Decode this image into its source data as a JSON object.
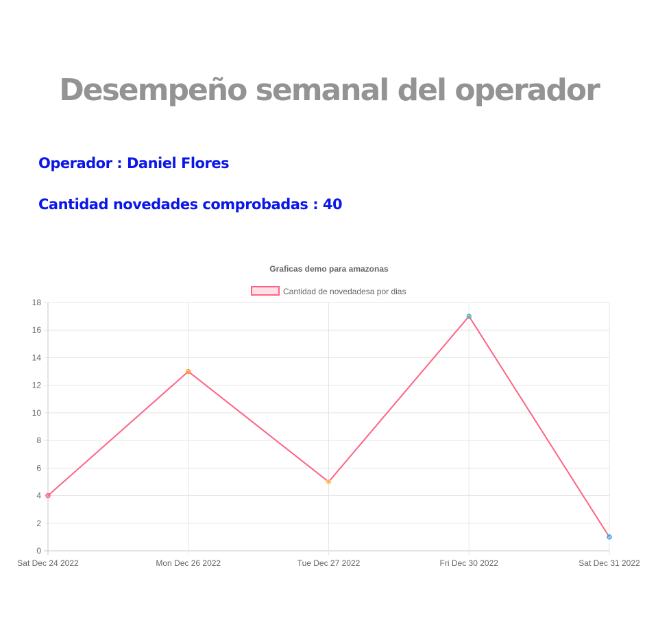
{
  "header": {
    "title": "Desempeño semanal del operador"
  },
  "info": {
    "operator_label": "Operador : Daniel Flores",
    "count_label": "Cantidad novedades comprobadas : 40",
    "text_color": "#0b17e8"
  },
  "chart_data": {
    "type": "line",
    "title": "Graficas demo para amazonas",
    "categories": [
      "Sat Dec 24 2022",
      "Mon Dec 26 2022",
      "Tue Dec 27 2022",
      "Fri Dec 30 2022",
      "Sat Dec 31 2022"
    ],
    "series": [
      {
        "name": "Cantidad de novedadesa por dias",
        "values": [
          4,
          13,
          5,
          17,
          1
        ],
        "line_color": "#ff6384",
        "fill_color": "rgba(255,99,132,0.2)",
        "point_colors": [
          "#ff6384",
          "#ff9f40",
          "#ffcd56",
          "#4bc0c0",
          "#36a2eb"
        ]
      }
    ],
    "ylim": [
      0,
      18
    ],
    "yticks": [
      0,
      2,
      4,
      6,
      8,
      10,
      12,
      14,
      16,
      18
    ],
    "grid": true,
    "legend_position": "top"
  }
}
